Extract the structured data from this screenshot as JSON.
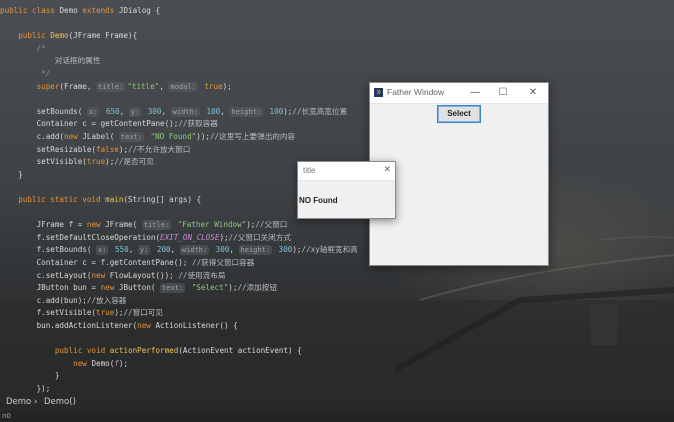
{
  "editor": {
    "lines": [
      {
        "parts": [
          [
            "kw",
            "public class "
          ],
          [
            "type",
            "Demo "
          ],
          [
            "kw",
            "extends "
          ],
          [
            "type",
            "JDialog {"
          ]
        ]
      },
      {
        "parts": []
      },
      {
        "parts": [
          [
            "kw",
            "    public "
          ],
          [
            "fn",
            "Demo"
          ],
          [
            "type",
            "(JFrame Frame){"
          ]
        ]
      },
      {
        "parts": [
          [
            "cm",
            "        /*"
          ]
        ]
      },
      {
        "parts": [
          [
            "cmz",
            "            对话框的属性"
          ]
        ]
      },
      {
        "parts": [
          [
            "cm",
            "         */"
          ]
        ]
      },
      {
        "parts": [
          [
            "kw",
            "        super"
          ],
          [
            "type",
            "(Frame, "
          ],
          [
            "hint",
            "title:"
          ],
          [
            "str",
            "\"title\""
          ],
          [
            "type",
            ", "
          ],
          [
            "hint",
            "modal:"
          ],
          [
            "kw",
            " true"
          ],
          [
            "type",
            ");"
          ]
        ]
      },
      {
        "parts": []
      },
      {
        "parts": [
          [
            "type",
            "        setBounds( "
          ],
          [
            "hint",
            "x:"
          ],
          [
            "num",
            " 650"
          ],
          [
            "type",
            ", "
          ],
          [
            "hint",
            "y:"
          ],
          [
            "num",
            " 300"
          ],
          [
            "type",
            ", "
          ],
          [
            "hint",
            "width:"
          ],
          [
            "num",
            " 100"
          ],
          [
            "type",
            ", "
          ],
          [
            "hint",
            "height:"
          ],
          [
            "num",
            " 100"
          ],
          [
            "type",
            ");"
          ],
          [
            "cmz",
            "//长宽高宽位置"
          ]
        ]
      },
      {
        "parts": [
          [
            "type",
            "        Container c = getContentPane();"
          ],
          [
            "cmz",
            "//获取容器"
          ]
        ]
      },
      {
        "parts": [
          [
            "type",
            "        c.add("
          ],
          [
            "kw",
            "new "
          ],
          [
            "type",
            "JLabel( "
          ],
          [
            "hint",
            "text:"
          ],
          [
            "str",
            " \"NO Found\""
          ],
          [
            "type",
            "));"
          ],
          [
            "cmz",
            "//这里写上要弹出的内容"
          ]
        ]
      },
      {
        "parts": [
          [
            "type",
            "        setResizable("
          ],
          [
            "kw",
            "false"
          ],
          [
            "type",
            ");"
          ],
          [
            "cmz",
            "//不允许放大窗口"
          ]
        ]
      },
      {
        "parts": [
          [
            "type",
            "        setVisible("
          ],
          [
            "kw",
            "true"
          ],
          [
            "type",
            ");"
          ],
          [
            "cmz",
            "//是否可见"
          ]
        ]
      },
      {
        "parts": [
          [
            "type",
            "    }"
          ]
        ]
      },
      {
        "parts": []
      },
      {
        "parts": [
          [
            "kw",
            "    public static void "
          ],
          [
            "fn",
            "main"
          ],
          [
            "type",
            "(String[] args) {"
          ]
        ]
      },
      {
        "parts": []
      },
      {
        "parts": [
          [
            "type",
            "        JFrame f = "
          ],
          [
            "kw",
            "new "
          ],
          [
            "type",
            "JFrame( "
          ],
          [
            "hint",
            "title:"
          ],
          [
            "str",
            " \"Father Window\""
          ],
          [
            "type",
            ");"
          ],
          [
            "cmz",
            "//父窗口"
          ]
        ]
      },
      {
        "parts": [
          [
            "type",
            "        f.setDefaultCloseOperation("
          ],
          [
            "const",
            "EXIT_ON_CLOSE"
          ],
          [
            "type",
            ");"
          ],
          [
            "cmz",
            "//父窗口关闭方式"
          ]
        ]
      },
      {
        "parts": [
          [
            "type",
            "        f.setBounds( "
          ],
          [
            "hint",
            "x:"
          ],
          [
            "num",
            " 550"
          ],
          [
            "type",
            ", "
          ],
          [
            "hint",
            "y:"
          ],
          [
            "num",
            " 200"
          ],
          [
            "type",
            ", "
          ],
          [
            "hint",
            "width:"
          ],
          [
            "num",
            " 300"
          ],
          [
            "type",
            ", "
          ],
          [
            "hint",
            "height:"
          ],
          [
            "num",
            " 300"
          ],
          [
            "type",
            ");"
          ],
          [
            "cmz",
            "//xy轴框宽和高"
          ]
        ]
      },
      {
        "parts": [
          [
            "type",
            "        Container c = f.getContentPane(); "
          ],
          [
            "cmz",
            "//获得父窗口容器"
          ]
        ]
      },
      {
        "parts": [
          [
            "type",
            "        c.setLayout("
          ],
          [
            "kw",
            "new "
          ],
          [
            "type",
            "FlowLayout()); "
          ],
          [
            "cmz",
            "//使用流布局"
          ]
        ]
      },
      {
        "parts": [
          [
            "type",
            "        JButton bun = "
          ],
          [
            "kw",
            "new "
          ],
          [
            "type",
            "JButton( "
          ],
          [
            "hint",
            "text:"
          ],
          [
            "str",
            " \"Select\""
          ],
          [
            "type",
            ");"
          ],
          [
            "cmz",
            "//添加按钮"
          ]
        ]
      },
      {
        "parts": [
          [
            "type",
            "        c.add(bun);"
          ],
          [
            "cmz",
            "//放入容器"
          ]
        ]
      },
      {
        "parts": [
          [
            "type",
            "        f.setVisible("
          ],
          [
            "kw",
            "true"
          ],
          [
            "type",
            ");"
          ],
          [
            "cmz",
            "//窗口可见"
          ]
        ]
      },
      {
        "parts": [
          [
            "type",
            "        bun.addActionListener("
          ],
          [
            "kw",
            "new "
          ],
          [
            "type",
            "ActionListener() {"
          ]
        ]
      },
      {
        "parts": []
      },
      {
        "parts": [
          [
            "kw",
            "            public void "
          ],
          [
            "fn",
            "actionPerformed"
          ],
          [
            "type",
            "(ActionEvent actionEvent) {"
          ]
        ]
      },
      {
        "parts": [
          [
            "kw",
            "                new "
          ],
          [
            "type",
            "Demo("
          ],
          [
            "const",
            "f"
          ],
          [
            "type",
            ");"
          ]
        ]
      },
      {
        "parts": [
          [
            "type",
            "            }"
          ]
        ]
      },
      {
        "parts": [
          [
            "type",
            "        });"
          ]
        ]
      }
    ]
  },
  "breadcrumbs": {
    "class": "Demo",
    "separator": "›",
    "method": "Demo()"
  },
  "status": {
    "position": "n0"
  },
  "father_window": {
    "title": "Father Window",
    "minimize": "—",
    "maximize": "☐",
    "close": "✕",
    "button_label": "Select"
  },
  "dialog": {
    "title": "title",
    "close": "✕",
    "message": "NO Found"
  },
  "colors": {
    "accent": "#3c82c8",
    "keyword": "#e5943b",
    "string": "#8ec77a"
  }
}
